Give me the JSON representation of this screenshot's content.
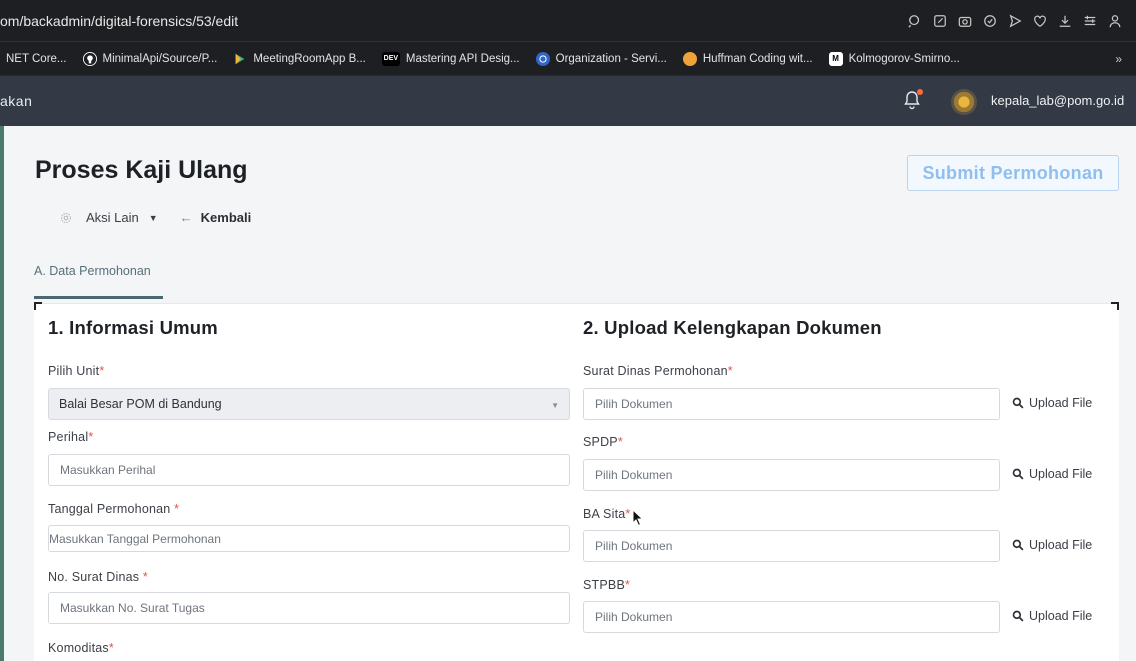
{
  "browser": {
    "url_host": "om/backadmin/digital-forensics/53/edit",
    "bookmarks": [
      {
        "label": "NET Core...",
        "icon": "none",
        "color": ""
      },
      {
        "label": "MinimalApi/Source/P...",
        "icon": "github-icon",
        "color": "#ffffff"
      },
      {
        "label": "MeetingRoomApp B...",
        "icon": "play-store-icon",
        "color": "#3bb26e"
      },
      {
        "label": "Mastering API Desig...",
        "icon": "dev-icon",
        "color": "#000000"
      },
      {
        "label": "Organization - Servi...",
        "icon": "globe-icon",
        "color": "#2f66c7"
      },
      {
        "label": "Huffman Coding wit...",
        "icon": "avatar-icon",
        "color": "#f0a23a"
      },
      {
        "label": "Kolmogorov-Smirno...",
        "icon": "medium-icon",
        "color": "#222222"
      }
    ],
    "more_label": "»"
  },
  "header": {
    "brand_text": "akan",
    "email": "kepala_lab@pom.go.id"
  },
  "page": {
    "title": "Proses Kaji Ulang",
    "submit_label": "Submit Permohonan",
    "actions_label": "Aksi Lain",
    "back_label": "Kembali",
    "tab_label": "A. Data Permohonan"
  },
  "section1": {
    "title": "1. Informasi Umum",
    "unit_label": "Pilih Unit",
    "unit_value": "Balai Besar POM di Bandung",
    "perihal_label": "Perihal",
    "perihal_placeholder": "Masukkan Perihal",
    "tanggal_label": "Tanggal Permohonan ",
    "tanggal_placeholder": "Masukkan Tanggal Permohonan",
    "surat_label": "No. Surat Dinas ",
    "surat_placeholder": "Masukkan No. Surat Tugas",
    "komoditas_label": "Komoditas"
  },
  "section2": {
    "title": "2. Upload Kelengkapan Dokumen",
    "upload_label": "Upload File",
    "doc_placeholder": "Pilih Dokumen",
    "docs": [
      {
        "label": "Surat Dinas Permohonan"
      },
      {
        "label": "SPDP"
      },
      {
        "label": "BA Sita"
      },
      {
        "label": "STPBB"
      }
    ]
  },
  "required_mark": "*",
  "colors": {
    "header_bg": "#343a45",
    "submit_text": "#8fbfee",
    "required": "#e0564a"
  }
}
